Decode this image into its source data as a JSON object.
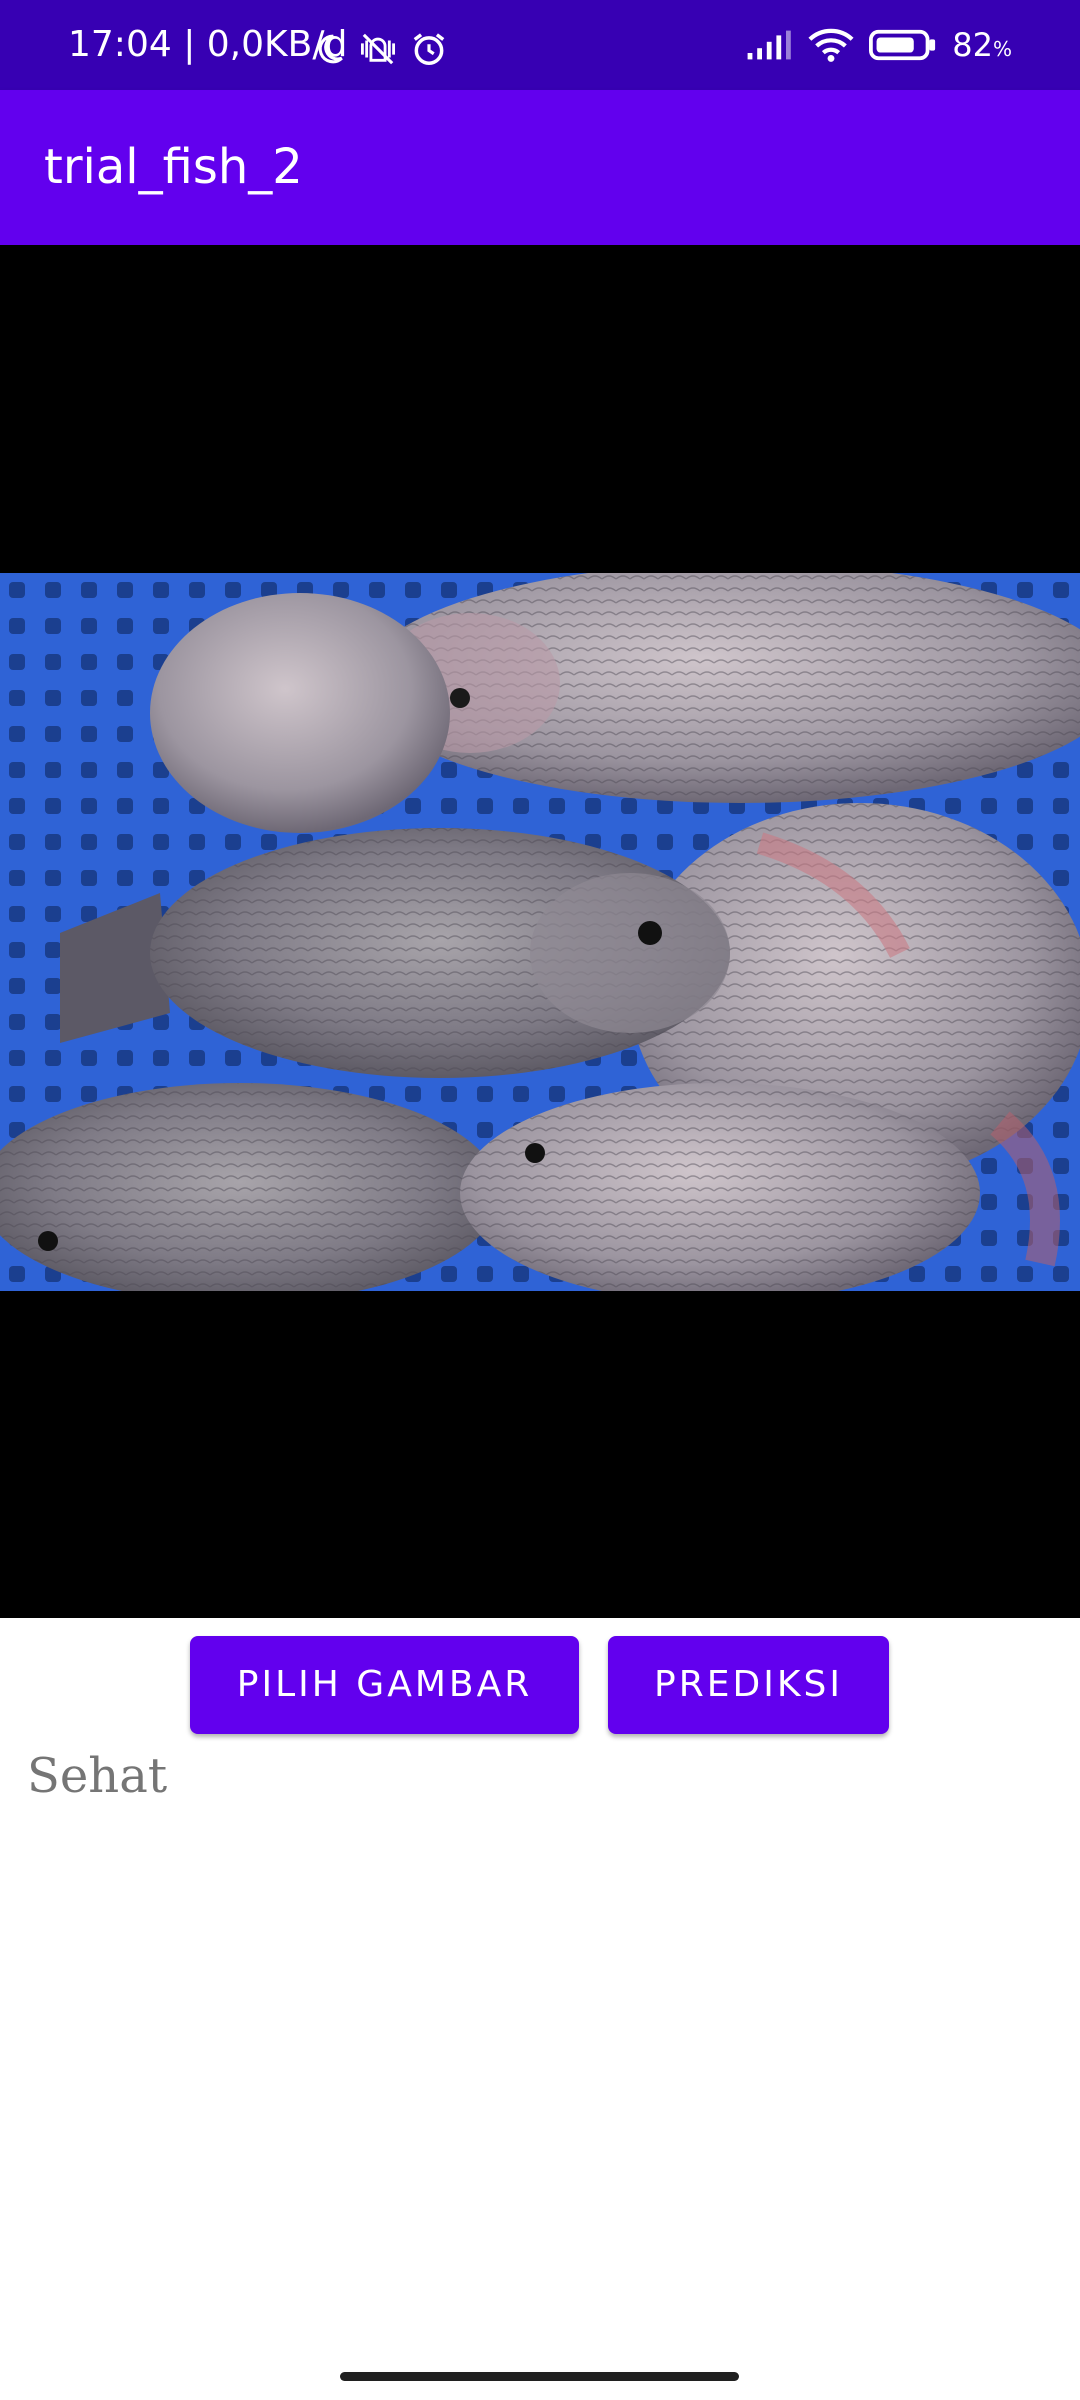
{
  "status_bar": {
    "time_and_speed": "17:04 | 0,0KB/d",
    "battery_percent": "82",
    "battery_percent_sign": "%",
    "battery_level": 0.82
  },
  "app_bar": {
    "title": "trial_fish_2"
  },
  "image_view": {
    "content": "tilapia fish photo"
  },
  "buttons": {
    "pick_image": "PILIH GAMBAR",
    "predict": "PREDIKSI"
  },
  "result": {
    "label": "Sehat"
  },
  "colors": {
    "status_bar": "#3700b3",
    "primary": "#6200ee",
    "image_bg": "#000000",
    "result_text": "#757575"
  }
}
